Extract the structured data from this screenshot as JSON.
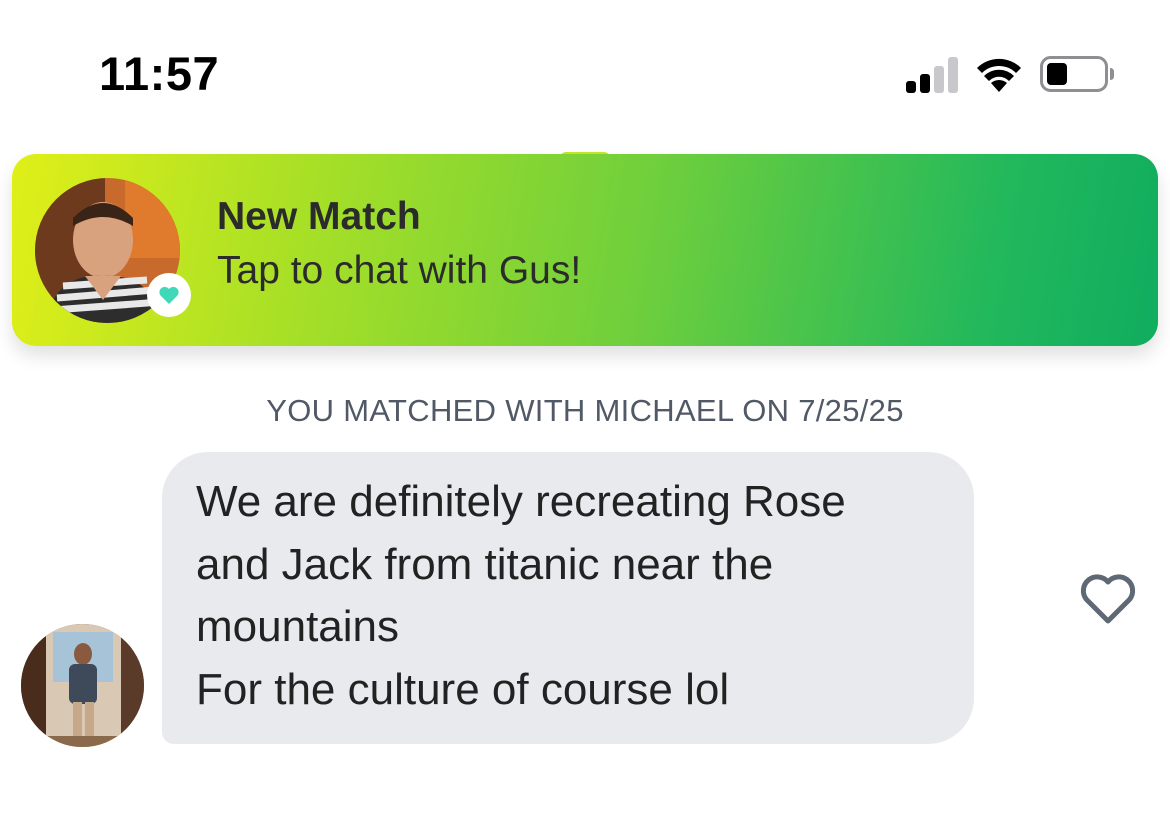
{
  "status_bar": {
    "time": "11:57",
    "icons": [
      "cellular-signal-icon",
      "wifi-icon",
      "battery-icon"
    ]
  },
  "notification": {
    "title": "New Match",
    "subtitle": "Tap to chat with Gus!",
    "badge_icon": "heart-icon",
    "badge_color": "#3fd8b8"
  },
  "chat": {
    "match_date": "YOU MATCHED WITH MICHAEL ON 7/25/25",
    "message": {
      "text": "We are definitely recreating Rose\nand Jack from titanic near the\nmountains\nFor the culture of course lol",
      "like_icon": "heart-outline-icon"
    }
  },
  "colors": {
    "banner_gradient_start": "#e0ef18",
    "banner_gradient_end": "#10ad5f",
    "bubble_bg": "#e9eaee",
    "date_text": "#505965"
  }
}
